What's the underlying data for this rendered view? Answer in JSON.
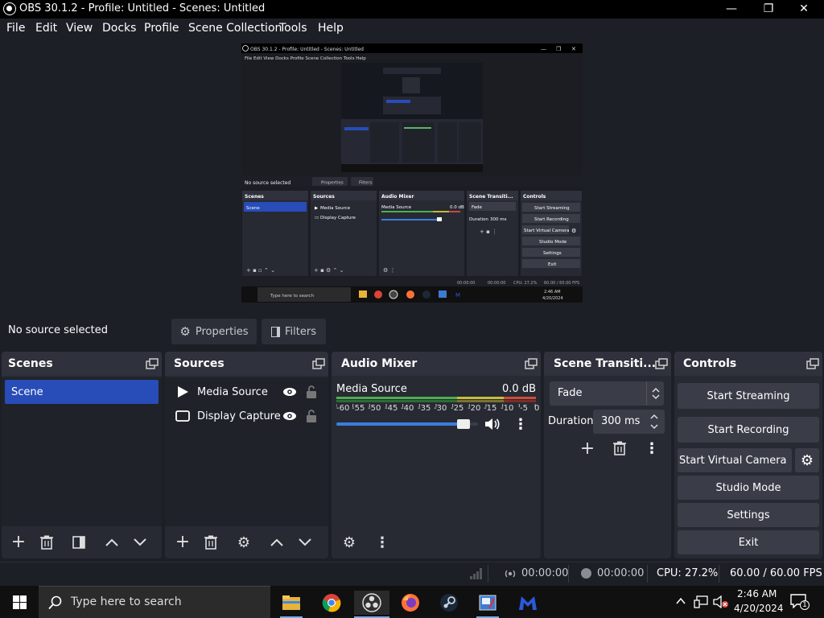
{
  "window": {
    "title": "OBS 30.1.2 - Profile: Untitled - Scenes: Untitled",
    "minimize": "—",
    "maximize": "❐",
    "close": "✕"
  },
  "menu": [
    "File",
    "Edit",
    "View",
    "Docks",
    "Profile",
    "Scene Collection",
    "Tools",
    "Help"
  ],
  "context_bar": {
    "no_source": "No source selected",
    "properties": "Properties",
    "filters": "Filters"
  },
  "scenes": {
    "title": "Scenes",
    "items": [
      {
        "label": "Scene",
        "selected": true
      }
    ]
  },
  "sources": {
    "title": "Sources",
    "items": [
      {
        "label": "Media Source",
        "icon": "play-icon"
      },
      {
        "label": "Display Capture",
        "icon": "monitor-icon"
      }
    ]
  },
  "audio_mixer": {
    "title": "Audio Mixer",
    "channel": {
      "name": "Media Source",
      "level": "0.0 dB",
      "volume_fraction": 0.94
    },
    "scale": [
      "-60",
      "-55",
      "-50",
      "-45",
      "-40",
      "-35",
      "-30",
      "-25",
      "-20",
      "-15",
      "-10",
      "-5",
      "0"
    ]
  },
  "scene_transitions": {
    "title": "Scene Transiti...",
    "transition": "Fade",
    "duration_label": "Duration",
    "duration_value": "300 ms"
  },
  "controls": {
    "title": "Controls",
    "start_streaming": "Start Streaming",
    "start_recording": "Start Recording",
    "start_virtual_camera": "Start Virtual Camera",
    "studio_mode": "Studio Mode",
    "settings": "Settings",
    "exit": "Exit"
  },
  "status": {
    "stream_time": "00:00:00",
    "record_time": "00:00:00",
    "cpu": "CPU: 27.2%",
    "fps": "60.00 / 60.00 FPS"
  },
  "taskbar": {
    "search_placeholder": "Type here to search",
    "time": "2:46 AM",
    "date": "4/20/2024",
    "notification_count": "1"
  },
  "nested_preview": {
    "window_title": "OBS 30.1.2 - Profile: Untitled - Scenes: Untitled",
    "menu": "File  Edit  View  Docks  Profile  Scene Collection  Tools  Help",
    "no_source": "No source selected",
    "properties": "Properties",
    "filters": "Filters",
    "scenes": "Scenes",
    "scene": "Scene",
    "sources": "Sources",
    "media_source": "Media Source",
    "display_capture": "Display Capture",
    "audio_mixer": "Audio Mixer",
    "level": "0.0 dB",
    "transitions": "Scene Transiti...",
    "fade": "Fade",
    "duration": "Duration",
    "duration_value": "300 ms",
    "controls": "Controls",
    "start_streaming": "Start Streaming",
    "start_recording": "Start Recording",
    "start_virtual_camera": "Start Virtual Camera",
    "studio_mode": "Studio Mode",
    "settings": "Settings",
    "exit": "Exit",
    "search": "Type here to search",
    "stream_time": "00:00:00",
    "record_time": "00:00:00",
    "cpu": "CPU: 27.2%",
    "fps": "60.00 / 60.00 FPS",
    "time": "2:46 AM",
    "date": "4/20/2024"
  },
  "colors": {
    "accent": "#284cb8",
    "background": "#1d1f26",
    "dock": "#272a33",
    "button": "#3a3d48"
  }
}
